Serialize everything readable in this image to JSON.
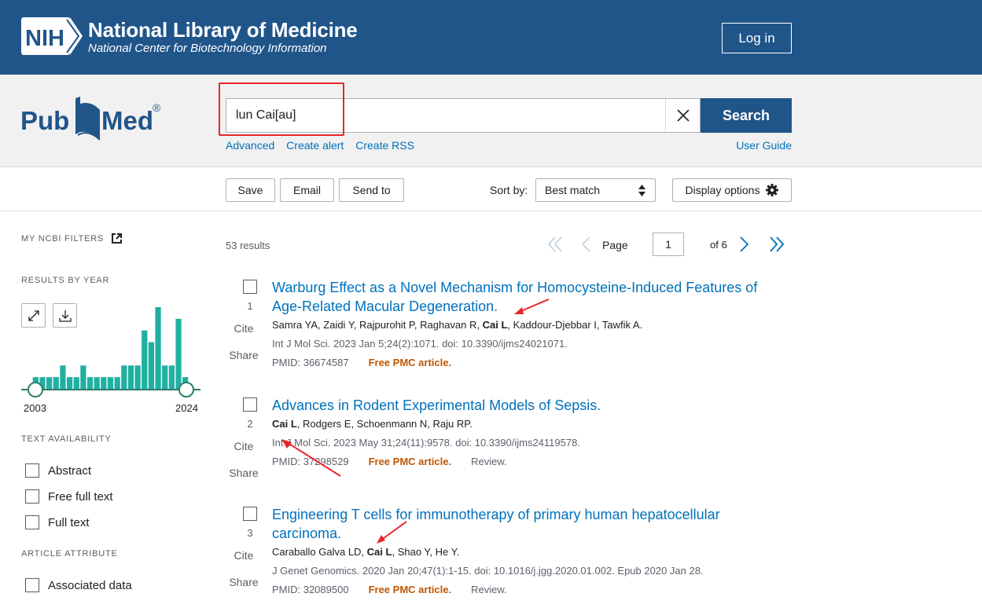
{
  "header": {
    "logo_text": "NIH",
    "title": "National Library of Medicine",
    "subtitle": "National Center for Biotechnology Information",
    "login_label": "Log in"
  },
  "search": {
    "logo_text_left": "Pub",
    "logo_text_right": "Med",
    "logo_reg": "®",
    "query": "lun Cai[au]",
    "button_label": "Search",
    "links": [
      "Advanced",
      "Create alert",
      "Create RSS"
    ],
    "user_guide": "User Guide"
  },
  "toolbar": {
    "save": "Save",
    "email": "Email",
    "send_to": "Send to",
    "sort_label": "Sort by:",
    "sort_value": "Best match",
    "display_options": "Display options"
  },
  "sidebar": {
    "my_ncbi_filters": "MY NCBI FILTERS",
    "results_by_year": "RESULTS BY YEAR",
    "year_start": "2003",
    "year_end": "2024",
    "year_counts": [
      1,
      1,
      1,
      1,
      2,
      1,
      1,
      2,
      1,
      1,
      1,
      1,
      1,
      2,
      2,
      2,
      5,
      4,
      7,
      2,
      2,
      6,
      1
    ],
    "text_availability": "TEXT AVAILABILITY",
    "text_filters": [
      "Abstract",
      "Free full text",
      "Full text"
    ],
    "article_attribute": "ARTICLE ATTRIBUTE",
    "attribute_filters": [
      "Associated data"
    ]
  },
  "results": {
    "count": "53 results",
    "page_label": "Page",
    "page_value": "1",
    "page_of": "of 6",
    "items": [
      {
        "num": "1",
        "title": "Warburg Effect as a Novel Mechanism for Homocysteine-Induced Features of Age-Related Macular Degeneration.",
        "authors_before": "Samra YA, Zaidi Y, Rajpurohit P, Raghavan R, ",
        "author_highlight": "Cai L",
        "authors_after": ", Kaddour-Djebbar I, Tawfik A.",
        "citation": "Int J Mol Sci. 2023 Jan 5;24(2):1071. doi: 10.3390/ijms24021071.",
        "pmid": "PMID: 36674587",
        "free": "Free PMC article.",
        "review": "",
        "cite": "Cite",
        "share": "Share"
      },
      {
        "num": "2",
        "title": "Advances in Rodent Experimental Models of Sepsis.",
        "authors_before": "",
        "author_highlight": "Cai L",
        "authors_after": ", Rodgers E, Schoenmann N, Raju RP.",
        "citation": "Int J Mol Sci. 2023 May 31;24(11):9578. doi: 10.3390/ijms24119578.",
        "pmid": "PMID: 37298529",
        "free": "Free PMC article.",
        "review": "Review.",
        "cite": "Cite",
        "share": "Share"
      },
      {
        "num": "3",
        "title": "Engineering T cells for immunotherapy of primary human hepatocellular carcinoma.",
        "authors_before": "Caraballo Galva LD, ",
        "author_highlight": "Cai L",
        "authors_after": ", Shao Y, He Y.",
        "citation": "J Genet Genomics. 2020 Jan 20;47(1):1-15. doi: 10.1016/j.jgg.2020.01.002. Epub 2020 Jan 28.",
        "pmid": "PMID: 32089500",
        "free": "Free PMC article.",
        "review": "Review.",
        "cite": "Cite",
        "share": "Share"
      }
    ]
  },
  "colors": {
    "header_bg": "#20558a",
    "link": "#0071bc",
    "free_pmc": "#c05600",
    "chart_bar": "#20b0a0",
    "annotation": "#e8262b"
  }
}
